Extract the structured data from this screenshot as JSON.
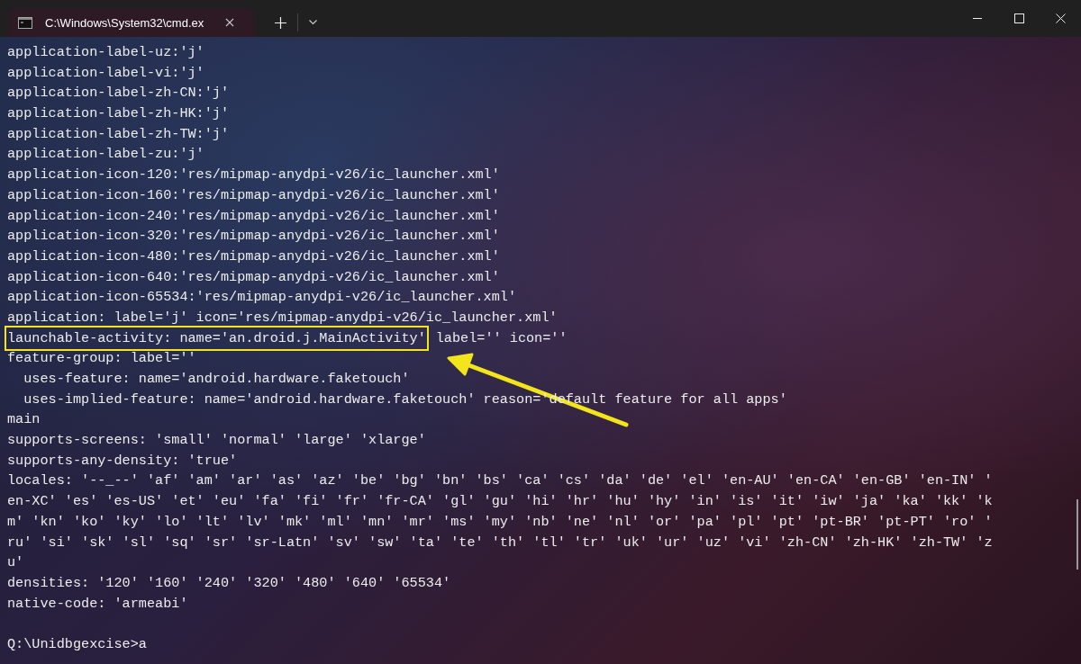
{
  "window": {
    "tab_title": "C:\\Windows\\System32\\cmd.ex",
    "tab_selected": true
  },
  "console": {
    "lines": [
      {
        "kind": "plain",
        "text": "application-label-uz:'j'"
      },
      {
        "kind": "plain",
        "text": "application-label-vi:'j'"
      },
      {
        "kind": "plain",
        "text": "application-label-zh-CN:'j'"
      },
      {
        "kind": "plain",
        "text": "application-label-zh-HK:'j'"
      },
      {
        "kind": "plain",
        "text": "application-label-zh-TW:'j'"
      },
      {
        "kind": "plain",
        "text": "application-label-zu:'j'"
      },
      {
        "kind": "plain",
        "text": "application-icon-120:'res/mipmap-anydpi-v26/ic_launcher.xml'"
      },
      {
        "kind": "plain",
        "text": "application-icon-160:'res/mipmap-anydpi-v26/ic_launcher.xml'"
      },
      {
        "kind": "plain",
        "text": "application-icon-240:'res/mipmap-anydpi-v26/ic_launcher.xml'"
      },
      {
        "kind": "plain",
        "text": "application-icon-320:'res/mipmap-anydpi-v26/ic_launcher.xml'"
      },
      {
        "kind": "plain",
        "text": "application-icon-480:'res/mipmap-anydpi-v26/ic_launcher.xml'"
      },
      {
        "kind": "plain",
        "text": "application-icon-640:'res/mipmap-anydpi-v26/ic_launcher.xml'"
      },
      {
        "kind": "plain",
        "text": "application-icon-65534:'res/mipmap-anydpi-v26/ic_launcher.xml'"
      },
      {
        "kind": "plain",
        "text": "application: label='j' icon='res/mipmap-anydpi-v26/ic_launcher.xml'"
      },
      {
        "kind": "highlighted",
        "text": "launchable-activity: name='an.droid.j.MainActivity'",
        "rest": "label='' icon=''"
      },
      {
        "kind": "plain",
        "text": "feature-group: label=''"
      },
      {
        "kind": "plain",
        "text": "  uses-feature: name='android.hardware.faketouch'"
      },
      {
        "kind": "plain",
        "text": "  uses-implied-feature: name='android.hardware.faketouch' reason='default feature for all apps'"
      },
      {
        "kind": "plain",
        "text": "main"
      },
      {
        "kind": "plain",
        "text": "supports-screens: 'small' 'normal' 'large' 'xlarge'"
      },
      {
        "kind": "plain",
        "text": "supports-any-density: 'true'"
      },
      {
        "kind": "plain",
        "text": "locales: '--_--' 'af' 'am' 'ar' 'as' 'az' 'be' 'bg' 'bn' 'bs' 'ca' 'cs' 'da' 'de' 'el' 'en-AU' 'en-CA' 'en-GB' 'en-IN' '"
      },
      {
        "kind": "plain",
        "text": "en-XC' 'es' 'es-US' 'et' 'eu' 'fa' 'fi' 'fr' 'fr-CA' 'gl' 'gu' 'hi' 'hr' 'hu' 'hy' 'in' 'is' 'it' 'iw' 'ja' 'ka' 'kk' 'k"
      },
      {
        "kind": "plain",
        "text": "m' 'kn' 'ko' 'ky' 'lo' 'lt' 'lv' 'mk' 'ml' 'mn' 'mr' 'ms' 'my' 'nb' 'ne' 'nl' 'or' 'pa' 'pl' 'pt' 'pt-BR' 'pt-PT' 'ro' '"
      },
      {
        "kind": "plain",
        "text": "ru' 'si' 'sk' 'sl' 'sq' 'sr' 'sr-Latn' 'sv' 'sw' 'ta' 'te' 'th' 'tl' 'tr' 'uk' 'ur' 'uz' 'vi' 'zh-CN' 'zh-HK' 'zh-TW' 'z"
      },
      {
        "kind": "plain",
        "text": "u'"
      },
      {
        "kind": "plain",
        "text": "densities: '120' '160' '240' '320' '480' '640' '65534'"
      },
      {
        "kind": "plain",
        "text": "native-code: 'armeabi'"
      },
      {
        "kind": "prompt",
        "text": "Q:\\Unidbgexcise>a"
      }
    ]
  }
}
